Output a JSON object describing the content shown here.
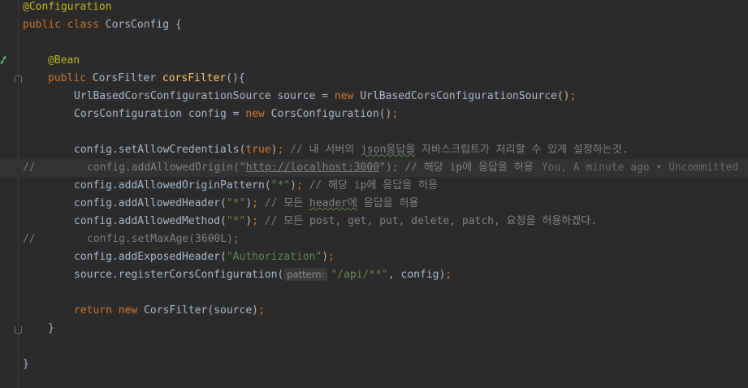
{
  "colors": {
    "background": "#2b2b2b",
    "keyword": "#cc7832",
    "annotation": "#bbb529",
    "string": "#6a8759",
    "comment": "#808080",
    "method": "#ffc66d",
    "text": "#a9b7c6"
  },
  "gutter": {
    "bean_icon": "bean-icon"
  },
  "lines": {
    "l1": {
      "annotation": "@Configuration"
    },
    "l2": {
      "kw": "public class ",
      "name": "CorsConfig {"
    },
    "l4": {
      "annotation": "@Bean"
    },
    "l5": {
      "kw": "public ",
      "type": "CorsFilter ",
      "method": "corsFilter",
      "rest": "(){"
    },
    "l6": {
      "a": "UrlBasedCorsConfigurationSource source = ",
      "kw": "new ",
      "b": "UrlBasedCorsConfigurationSource()",
      "semi": ";"
    },
    "l7": {
      "a": "CorsConfiguration config = ",
      "kw": "new ",
      "b": "CorsConfiguration()",
      "semi": ";"
    },
    "l9": {
      "a": "config.setAllowCredentials(",
      "kw": "true",
      "b": ")",
      "semi": ";",
      "comment_a": " // 내 서버의 ",
      "comment_squig": "json응답을",
      "comment_b": " 자바스크립트가 처리할 수 있게 설정하는것."
    },
    "l10": {
      "prefix": "//",
      "a": "config.addAllowedOrigin(\"",
      "link": "http://localhost:3000",
      "b": "\"); // 해당 ip에 응답을 허용",
      "blame": "You, A minute ago • Uncommitted"
    },
    "l11": {
      "a": "config.addAllowedOriginPattern(",
      "str": "\"*\"",
      "b": ")",
      "semi": ";",
      "comment": " // 해당 ip에 응답을 허용"
    },
    "l12": {
      "a": "config.addAllowedHeader(",
      "str": "\"*\"",
      "b": ")",
      "semi": ";",
      "comment_a": " // 모든 ",
      "comment_squig": "header에",
      "comment_b": " 응답을 허용"
    },
    "l13": {
      "a": "config.addAllowedMethod(",
      "str": "\"*\"",
      "b": ")",
      "semi": ";",
      "comment": " // 모든 post, get, put, delete, patch, 요청을 허용하겠다."
    },
    "l14": {
      "prefix": "//",
      "a": "config.setMaxAge(3600L);"
    },
    "l15": {
      "a": "config.addExposedHeader(",
      "str": "\"Authorization\"",
      "b": ")",
      "semi": ";"
    },
    "l16": {
      "a": "source.registerCorsConfiguration(",
      "hint": "pattern:",
      "str": "\"/api/**\"",
      "b": ", config)",
      "semi": ";"
    },
    "l18": {
      "kw": "return new ",
      "a": "CorsFilter(source)",
      "semi": ";"
    },
    "l19": {
      "a": "}"
    },
    "l21": {
      "a": "}"
    }
  }
}
